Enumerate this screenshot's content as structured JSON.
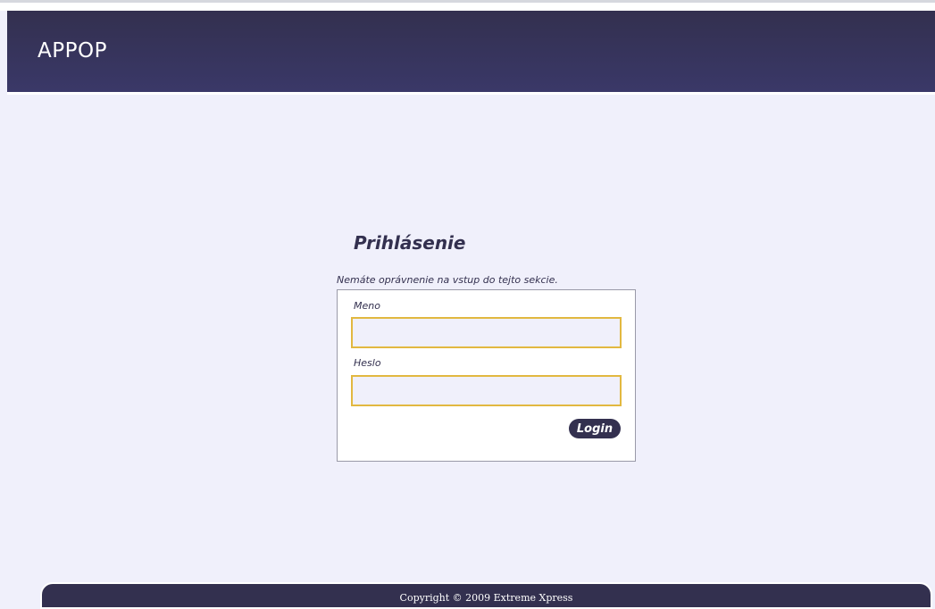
{
  "header": {
    "logo_text": "APPOP"
  },
  "login": {
    "title": "Prihlásenie",
    "notice": "Nemáte oprávnenie na vstup do tejto sekcie.",
    "username_label": "Meno",
    "username_value": "",
    "password_label": "Heslo",
    "password_value": "",
    "submit_label": "Login"
  },
  "footer": {
    "copyright": "Copyright © 2009 Extreme Xpress"
  },
  "colors": {
    "header_bg": "#33304f",
    "page_bg": "#f0f0fb",
    "input_border": "#e2b840",
    "text_accent": "#33304f"
  }
}
